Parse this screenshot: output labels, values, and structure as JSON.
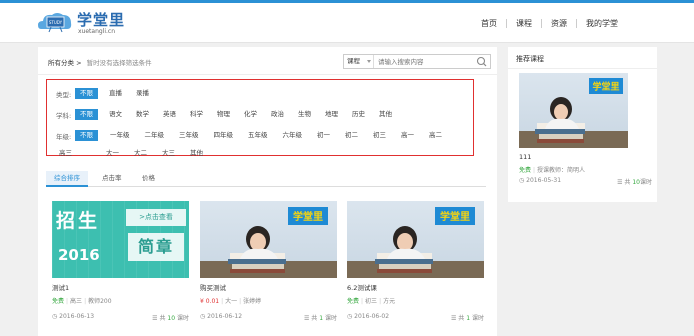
{
  "brand": {
    "name": "学堂里",
    "domain": "xuetangli.cn",
    "badge": "STUDY"
  },
  "nav": [
    {
      "label": "首页"
    },
    {
      "label": "课程"
    },
    {
      "label": "资源"
    },
    {
      "label": "我的学堂"
    }
  ],
  "breadcrumb": {
    "label": "所有分类 >",
    "hint": "暂时没有选择筛选条件"
  },
  "search": {
    "type_label": "课程",
    "placeholder": "请输入搜索内容"
  },
  "filters": {
    "type": {
      "label": "类型:",
      "options": [
        "不限",
        "直播",
        "录播"
      ]
    },
    "subject": {
      "label": "学科:",
      "options": [
        "不限",
        "语文",
        "数学",
        "英语",
        "科学",
        "物理",
        "化学",
        "政治",
        "生物",
        "地理",
        "历史",
        "其他"
      ]
    },
    "grade": {
      "label": "年级:",
      "options": [
        "不限",
        "一年级",
        "二年级",
        "三年级",
        "四年级",
        "五年级",
        "六年级",
        "初一",
        "初二",
        "初三",
        "高一",
        "高二",
        "高三",
        "大一",
        "大二",
        "大三",
        "其他"
      ]
    }
  },
  "tabs": [
    {
      "label": "综合排序"
    },
    {
      "label": "点击率"
    },
    {
      "label": "价格"
    }
  ],
  "thumb_text": {
    "logo": "学堂里",
    "banner_big1": "招生",
    "banner_arrow": ">点击查看",
    "banner_year": "2016",
    "banner_big2": "简章"
  },
  "courses": [
    {
      "title": "测试1",
      "price": "免费",
      "grade": "高三",
      "teacher": "教师200",
      "date": "2016-06-13",
      "lessons_pre": "共",
      "lessons": "10",
      "lessons_post": "课时"
    },
    {
      "title": "购买测试",
      "price": "¥ 0.01",
      "grade": "大一",
      "teacher": "张婷婷",
      "date": "2016-06-12",
      "lessons_pre": "共",
      "lessons": "1",
      "lessons_post": "课时"
    },
    {
      "title": "6.2测试课",
      "price": "免费",
      "grade": "初三",
      "teacher": "方元",
      "date": "2016-06-02",
      "lessons_pre": "共",
      "lessons": "1",
      "lessons_post": "课时"
    }
  ],
  "sidebar": {
    "title": "推荐课程",
    "course": {
      "title": "111",
      "price": "免费",
      "teacher": "授课教师：简明人",
      "date": "2016-05-31",
      "lessons_pre": "共",
      "lessons": "10",
      "lessons_post": "课时"
    }
  },
  "colors": {
    "accent": "#2b91d5",
    "filter_border": "#e03030",
    "free": "#36a840",
    "price": "#e03030"
  }
}
